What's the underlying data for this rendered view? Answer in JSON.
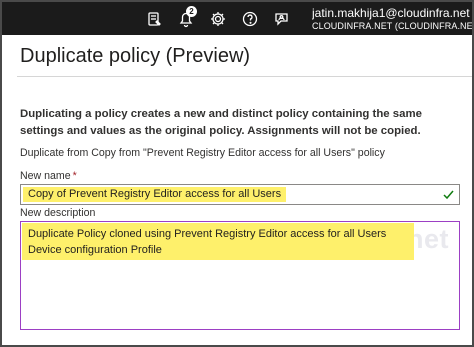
{
  "topbar": {
    "notification_count": "2",
    "account_name": "jatin.makhija1@cloudinfra.net",
    "account_tenant": "CLOUDINFRA.NET (CLOUDINFRA.NET)",
    "icons": [
      "feedback-icon",
      "notification-icon",
      "settings-icon",
      "help-icon",
      "support-icon"
    ]
  },
  "panel": {
    "title": "Duplicate policy (Preview)",
    "description": "Duplicating a policy creates a new and distinct policy containing the same settings and values as the original policy. Assignments will not be copied.",
    "source_text": "Duplicate from Copy from \"Prevent Registry Editor access for all Users\" policy",
    "new_name_label": "New name",
    "required_marker": "*",
    "new_name_value": "Copy of Prevent Registry Editor access for all Users",
    "new_description_label": "New description",
    "new_description_value": "Duplicate Policy cloned using Prevent Registry Editor access for all Users Device configuration Profile",
    "watermark": "Cloudinfra.net"
  },
  "colors": {
    "topbar_bg": "#1b1b1b",
    "highlight": "#fef06b",
    "focus_border": "#9c3fc4",
    "valid_check": "#107c10"
  }
}
